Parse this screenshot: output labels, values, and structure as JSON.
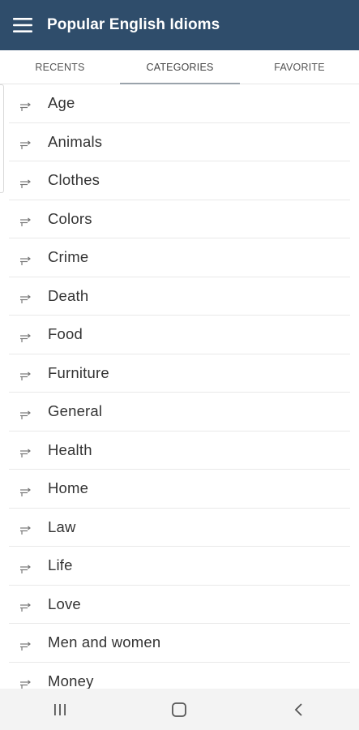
{
  "appbar": {
    "title": "Popular English Idioms",
    "menu_icon": "hamburger-menu-icon",
    "background": "#2f4d6b"
  },
  "tabs": [
    {
      "label": "RECENTS",
      "active": false
    },
    {
      "label": "CATEGORIES",
      "active": true
    },
    {
      "label": "FAVORITE",
      "active": false
    }
  ],
  "categories": {
    "icon": "category-arrow-icon",
    "items": [
      "Age",
      "Animals",
      "Clothes",
      "Colors",
      "Crime",
      "Death",
      "Food",
      "Furniture",
      "General",
      "Health",
      "Home",
      "Law",
      "Life",
      "Love",
      "Men and women",
      "Money"
    ]
  },
  "navbar": {
    "buttons": [
      {
        "name": "recent-apps-button",
        "icon": "recent-apps-icon"
      },
      {
        "name": "home-button",
        "icon": "home-icon"
      },
      {
        "name": "back-button",
        "icon": "back-icon"
      }
    ]
  }
}
